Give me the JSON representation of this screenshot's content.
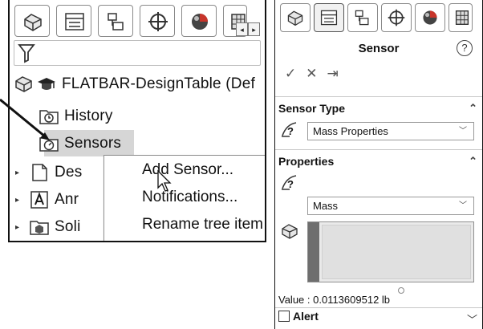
{
  "left_tree": {
    "part_name": "FLATBAR-DesignTable  (Def",
    "items": [
      {
        "label": "History"
      },
      {
        "label": "Sensors"
      },
      {
        "label": "Des"
      },
      {
        "label": "Anr"
      },
      {
        "label": "Soli"
      }
    ]
  },
  "context_menu": {
    "items": [
      {
        "label": "Add Sensor..."
      },
      {
        "label": "Notifications..."
      },
      {
        "label": "Rename tree item"
      }
    ]
  },
  "sensor_panel": {
    "title": "Sensor",
    "help": "?",
    "actions": {
      "ok": "✓",
      "cancel": "✕",
      "pin": "⇥"
    },
    "sensor_type": {
      "header": "Sensor Type",
      "value": "Mass Properties"
    },
    "properties": {
      "header": "Properties",
      "value": "Mass"
    },
    "value_readout": "Value : 0.0113609512 lb",
    "alert": {
      "label": "Alert",
      "checked": false
    }
  },
  "scroll_buttons": {
    "left": "◂",
    "right": "▸"
  },
  "colors": {
    "highlight": "#d6d6d6",
    "border": "#111111",
    "accent_red": "#c8352b"
  }
}
